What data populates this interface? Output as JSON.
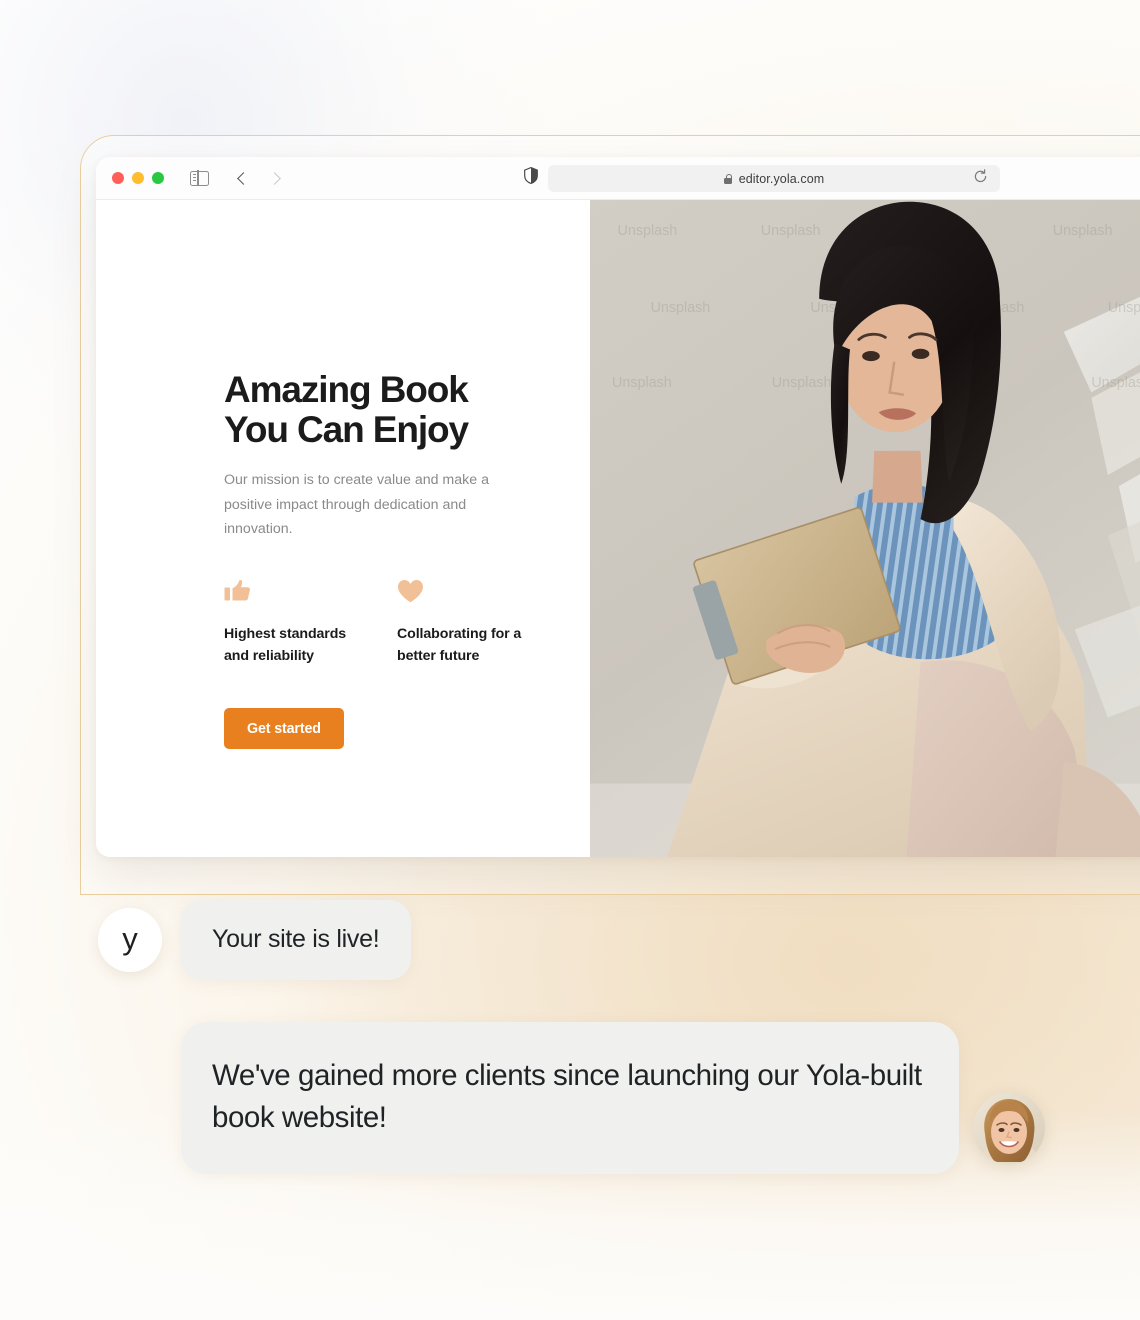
{
  "browser": {
    "traffic_lights": [
      "close",
      "minimize",
      "maximize"
    ],
    "sidebar_icon": "sidebar-toggle-icon",
    "back_icon": "chevron-left-icon",
    "forward_icon": "chevron-right-icon",
    "shield_icon": "privacy-shield-icon",
    "lock_icon": "lock-icon",
    "url": "editor.yola.com",
    "reload_icon": "reload-icon"
  },
  "site": {
    "headline": "Amazing Book\nYou Can Enjoy",
    "subcopy": "Our mission is to create value and make a positive impact through dedication and innovation.",
    "features": [
      {
        "icon": "thumbs-up-icon",
        "label": "Highest standards and reliability"
      },
      {
        "icon": "heart-icon",
        "label": "Collaborating for a better future"
      }
    ],
    "cta_label": "Get started",
    "hero_image_alt": "woman reading a book",
    "hero_watermarks": [
      "Unsplash",
      "Unsplash",
      "Unsplash",
      "Unsplash",
      "Unsplash",
      "Unsplash",
      "Unsplash",
      "Unsplash",
      "Unsplash",
      "Unsplash",
      "Unsplash",
      "Unsplash"
    ]
  },
  "chat": {
    "brand_avatar_letter": "y",
    "message_1": "Your site is live!",
    "message_2": "We've gained more clients since launching our Yola-built book website!",
    "customer_avatar_alt": "smiling woman portrait"
  },
  "colors": {
    "accent_orange": "#e8801f",
    "feature_icon_peach": "#f2c096",
    "border_tan": "#eccf9f",
    "bubble_gray": "#f0f0ee",
    "background_cream": "#f4e6d2"
  }
}
